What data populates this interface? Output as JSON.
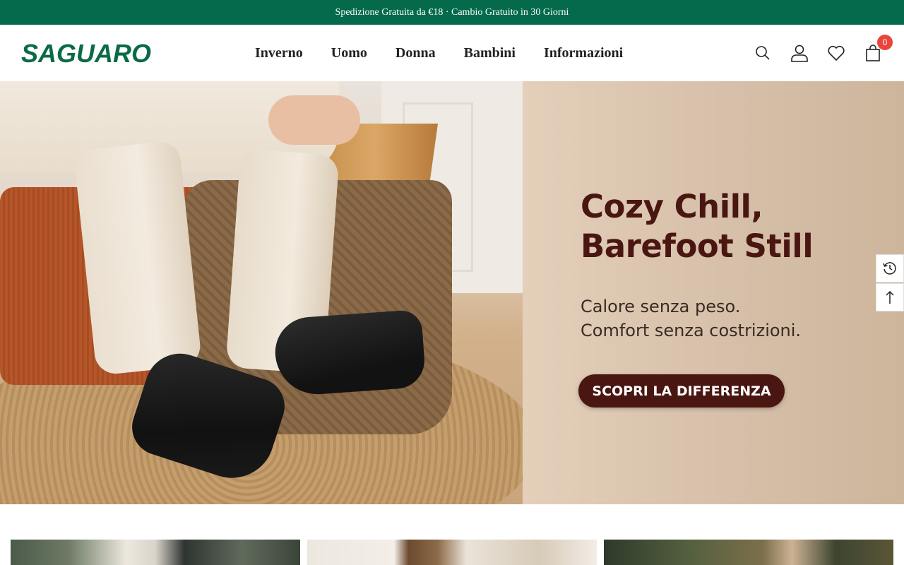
{
  "announcement": {
    "text": "Spedizione Gratuita da €18 · Cambio Gratuito in 30 Giorni"
  },
  "header": {
    "logo": "SAGUARO",
    "nav": [
      "Inverno",
      "Uomo",
      "Donna",
      "Bambini",
      "Informazioni"
    ],
    "icons": [
      "search-icon",
      "account-icon",
      "wishlist-heart-icon",
      "cart-bag-icon"
    ],
    "cart_count": "0"
  },
  "hero": {
    "headline_line1": "Cozy Chill,",
    "headline_line2": "Barefoot Still",
    "sub_line1": "Calore senza peso.",
    "sub_line2": "Comfort senza costrizioni.",
    "cta": "SCOPRI LA DIFFERENZA"
  },
  "side_buttons": [
    "recently-viewed-icon",
    "back-to-top-icon"
  ],
  "colors": {
    "announcement_bg": "#046a4b",
    "logo": "#0b6b47",
    "headline": "#4a1612",
    "cta_bg": "#4a1612",
    "badge": "#e8453c"
  }
}
